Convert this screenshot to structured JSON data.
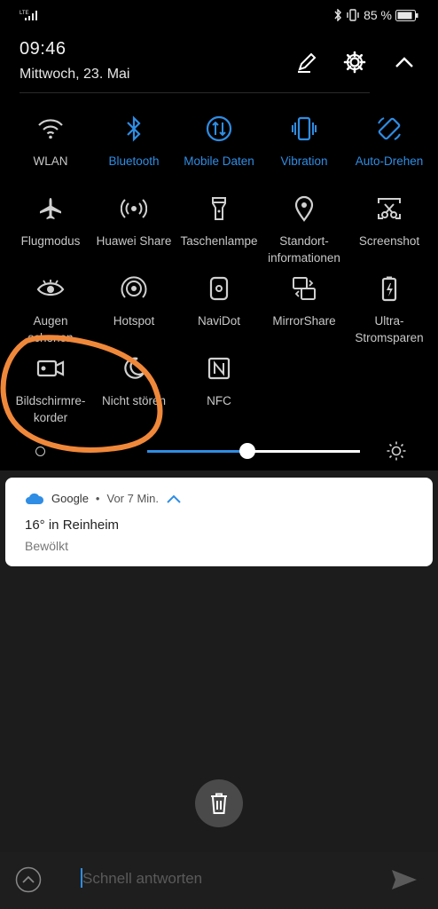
{
  "status": {
    "network": "LTE",
    "battery": "85 %"
  },
  "header": {
    "time": "09:46",
    "date": "Mittwoch, 23. Mai"
  },
  "tiles": [
    {
      "label": "WLAN",
      "icon": "wifi-icon",
      "on": false
    },
    {
      "label": "Bluetooth",
      "icon": "bluetooth-icon",
      "on": true
    },
    {
      "label": "Mobile Daten",
      "icon": "mobile-data-icon",
      "on": true
    },
    {
      "label": "Vibration",
      "icon": "vibration-icon",
      "on": true
    },
    {
      "label": "Auto-Drehen",
      "icon": "auto-rotate-icon",
      "on": true
    },
    {
      "label": "Flugmodus",
      "icon": "airplane-icon",
      "on": false
    },
    {
      "label": "Huawei Share",
      "icon": "huawei-share-icon",
      "on": false
    },
    {
      "label": "Taschenlampe",
      "icon": "flashlight-icon",
      "on": false
    },
    {
      "label": "Standort-\ninformationen",
      "icon": "location-icon",
      "on": false
    },
    {
      "label": "Screenshot",
      "icon": "screenshot-icon",
      "on": false
    },
    {
      "label": "Augen\nschonen",
      "icon": "eye-icon",
      "on": false
    },
    {
      "label": "Hotspot",
      "icon": "hotspot-icon",
      "on": false
    },
    {
      "label": "NaviDot",
      "icon": "navidot-icon",
      "on": false
    },
    {
      "label": "MirrorShare",
      "icon": "mirrorshare-icon",
      "on": false
    },
    {
      "label": "Ultra-\nStromsparen",
      "icon": "battery-saver-icon",
      "on": false
    },
    {
      "label": "Bildschirmre-\nkorder",
      "icon": "screen-recorder-icon",
      "on": false
    },
    {
      "label": "Nicht stören",
      "icon": "moon-icon",
      "on": false
    },
    {
      "label": "NFC",
      "icon": "nfc-icon",
      "on": false
    }
  ],
  "brightness": {
    "level": 0.6
  },
  "notification": {
    "app": "Google",
    "time": "Vor 7 Min.",
    "title": "16° in Reinheim",
    "text": "Bewölkt"
  },
  "reply": {
    "placeholder": "Schnell antworten"
  },
  "colors": {
    "accent": "#2f8de4",
    "annotation": "#f0883a"
  }
}
